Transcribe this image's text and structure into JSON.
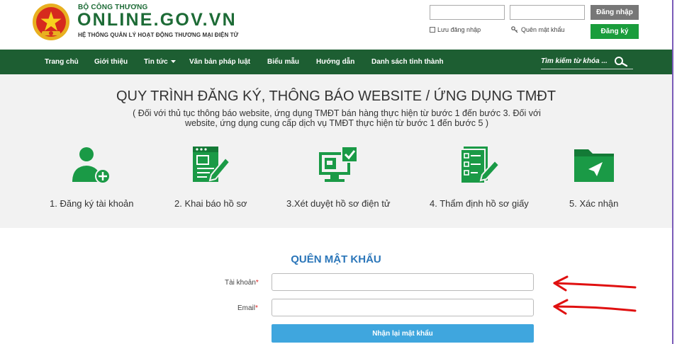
{
  "header": {
    "org": "BỘ CÔNG THƯƠNG",
    "site": "ONLINE.GOV.VN",
    "subtitle": "HỆ THỐNG QUẢN LÝ HOẠT ĐỘNG THƯƠNG MẠI ĐIỆN TỬ",
    "login_button": "Đăng nhập",
    "remember_label": "Lưu đăng nhập",
    "forgot_label": "Quên mật khẩu",
    "register_button": "Đăng ký"
  },
  "nav": {
    "items": [
      "Trang chủ",
      "Giới thiệu",
      "Tin tức",
      "Văn bản pháp luật",
      "Biểu mẫu",
      "Hướng dẫn",
      "Danh sách tỉnh thành"
    ],
    "search_placeholder": "Tìm kiếm từ khóa ..."
  },
  "process": {
    "title": "QUY TRÌNH ĐĂNG KÝ, THÔNG BÁO WEBSITE / ỨNG DỤNG TMĐT",
    "note": "( Đối với thủ tục thông báo website, ứng dụng TMĐT bán hàng thực hiện từ bước 1 đến bước 3. Đối với website, ứng dụng cung cấp dịch vụ TMĐT thực hiện từ bước 1 đến bước 5 )",
    "steps": [
      "1. Đăng ký tài khoản",
      "2. Khai báo hồ sơ",
      "3.Xét duyệt hồ sơ điện tử",
      "4. Thẩm định hồ sơ giấy",
      "5. Xác nhận"
    ]
  },
  "form": {
    "title": "QUÊN MẬT KHẨU",
    "account_label": "Tài khoản",
    "email_label": "Email",
    "required_mark": "*",
    "submit_label": "Nhận lại mật khẩu"
  },
  "colors": {
    "brand_green": "#1d5e32",
    "accent_blue": "#3fa6de",
    "annotation_red": "#e01010"
  }
}
